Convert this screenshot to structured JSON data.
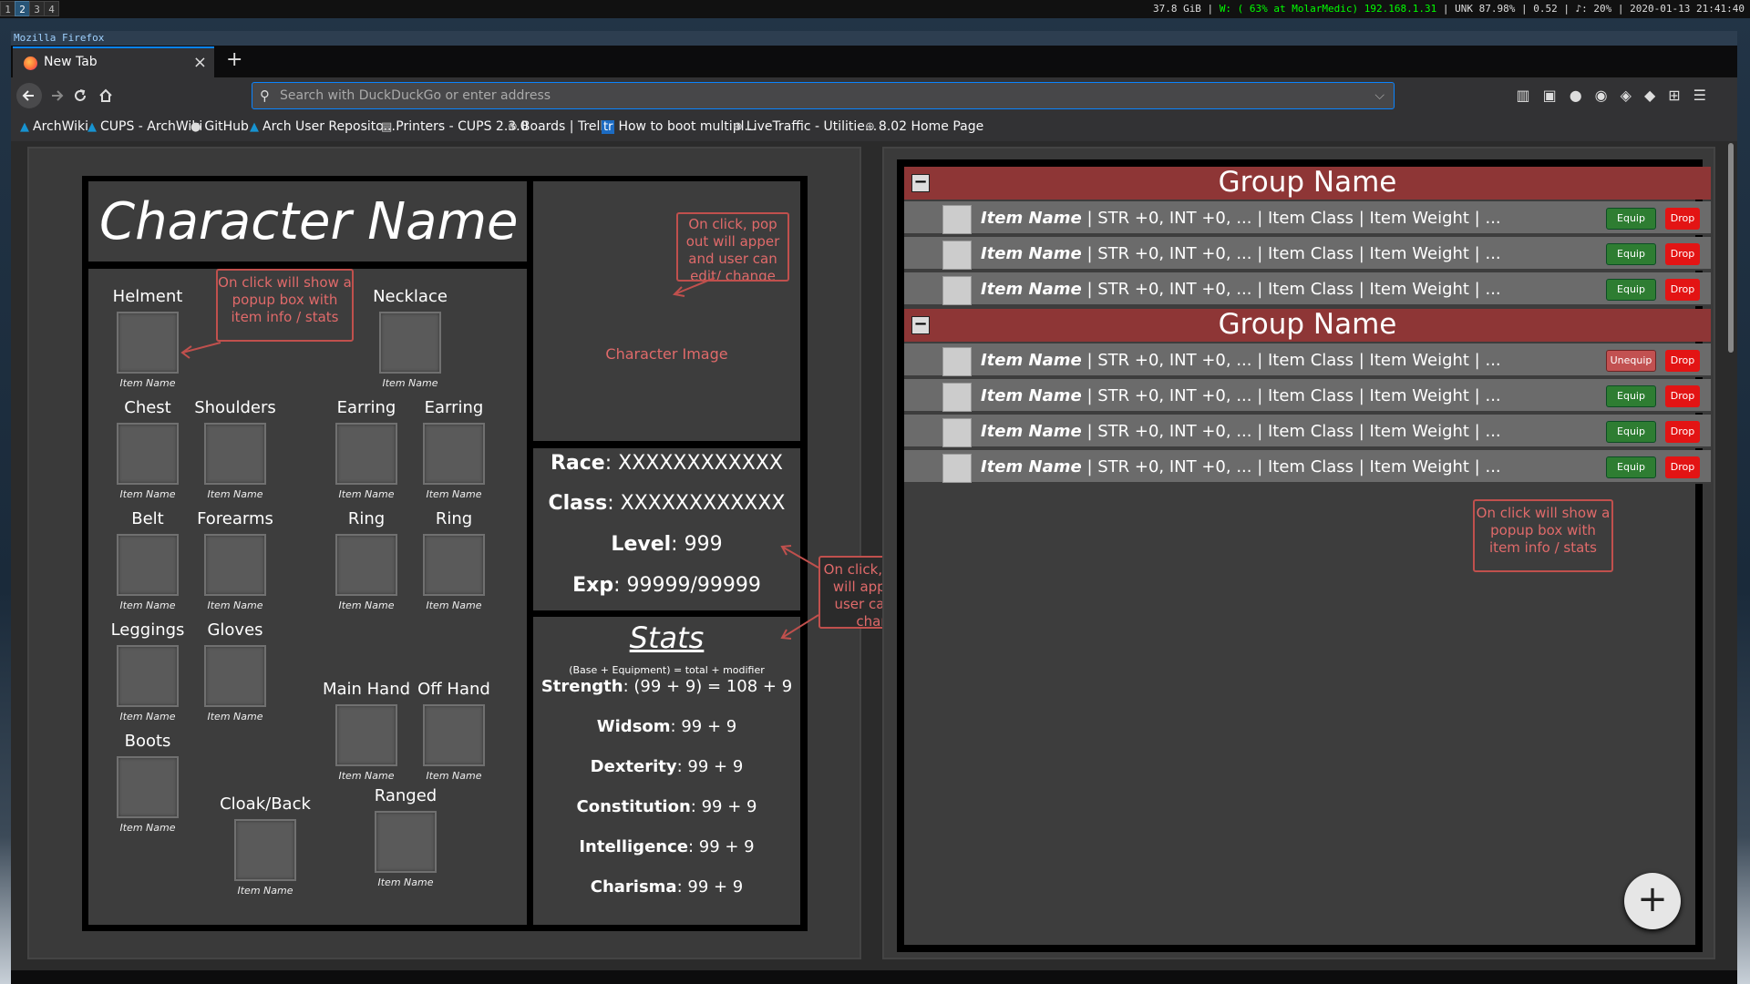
{
  "statusbar": {
    "workspaces": [
      "1",
      "2",
      "3",
      "4"
    ],
    "info": "37.8 GiB",
    "wifi": "W: ( 63% at MolarMedic) 192.168.1.31",
    "rest": "UNK 87.98% | 0.52 | ♪: 20% | 2020-01-13 21:41:40"
  },
  "browser": {
    "window_title": "Mozilla Firefox",
    "tab_label": "New Tab",
    "tab_close": "×",
    "new_tab": "+",
    "url_placeholder": "Search with DuckDuckGo or enter address",
    "bookmarks": [
      "ArchWiki",
      "CUPS - ArchWiki",
      "GitHub",
      "Arch User Reposito...",
      "Printers - CUPS 2.3.0",
      "Boards | Trello",
      "How to boot multipl...",
      "LiveTraffic - Utilitie...",
      "8.02 Home Page"
    ]
  },
  "character": {
    "name": "Character Name",
    "image_caption": "Character Image",
    "race_label": "Race",
    "race_value": ": XXXXXXXXXXXX",
    "class_label": "Class",
    "class_value": ": XXXXXXXXXXXX",
    "level_label": "Level",
    "level_value": ": 999",
    "exp_label": "Exp",
    "exp_value": ": 99999/99999"
  },
  "slots": [
    {
      "label": "Helment",
      "item": "Item Name"
    },
    {
      "label": "Necklace",
      "item": "Item Name"
    },
    {
      "label": "Chest",
      "item": "Item Name"
    },
    {
      "label": "Shoulders",
      "item": "Item Name"
    },
    {
      "label": "Earring",
      "item": "Item Name"
    },
    {
      "label": "Earring",
      "item": "Item Name"
    },
    {
      "label": "Belt",
      "item": "Item Name"
    },
    {
      "label": "Forearms",
      "item": "Item Name"
    },
    {
      "label": "Ring",
      "item": "Item Name"
    },
    {
      "label": "Ring",
      "item": "Item Name"
    },
    {
      "label": "Leggings",
      "item": "Item Name"
    },
    {
      "label": "Gloves",
      "item": "Item Name"
    },
    {
      "label": "Main Hand",
      "item": "Item Name"
    },
    {
      "label": "Off Hand",
      "item": "Item Name"
    },
    {
      "label": "Boots",
      "item": "Item Name"
    },
    {
      "label": "Cloak/Back",
      "item": "Item Name"
    },
    {
      "label": "Ranged",
      "item": "Item Name"
    }
  ],
  "stats": {
    "title": "Stats",
    "formula": "(Base + Equipment) = total + modifier",
    "rows": [
      {
        "name": "Strength",
        "value": ": (99 + 9) = 108 + 9"
      },
      {
        "name": "Widsom",
        "value": ": 99 + 9"
      },
      {
        "name": "Dexterity",
        "value": ": 99 + 9"
      },
      {
        "name": "Constitution",
        "value": ": 99 + 9"
      },
      {
        "name": "Intelligence",
        "value": ": 99 + 9"
      },
      {
        "name": "Charisma",
        "value": ": 99 + 9"
      }
    ]
  },
  "notes": {
    "slot_popup": "On click will show a popup box with item info / stats",
    "image_popout": "On click, pop out will apper and user can edit/ change",
    "info_popout": "On click, pop out will apper and user can edit/ change",
    "item_popup": "On click will show a popup box with item info / stats"
  },
  "inventory": {
    "groups": [
      {
        "name": "Group Name",
        "items": [
          {
            "name": "Item Name",
            "details": " | STR +0, INT +0, ... | Item Class | Item Weight | ...",
            "action": "Equip"
          },
          {
            "name": "Item Name",
            "details": " | STR +0, INT +0, ... | Item Class | Item Weight | ...",
            "action": "Equip"
          },
          {
            "name": "Item Name",
            "details": " | STR +0, INT +0, ... | Item Class | Item Weight | ...",
            "action": "Equip"
          }
        ]
      },
      {
        "name": "Group Name",
        "items": [
          {
            "name": "Item Name",
            "details": " | STR +0, INT +0, ... | Item Class | Item Weight | ...",
            "action": "Unequip"
          },
          {
            "name": "Item Name",
            "details": " | STR +0, INT +0, ... | Item Class | Item Weight | ...",
            "action": "Equip"
          },
          {
            "name": "Item Name",
            "details": " | STR +0, INT +0, ... | Item Class | Item Weight | ...",
            "action": "Equip"
          },
          {
            "name": "Item Name",
            "details": " | STR +0, INT +0, ... | Item Class | Item Weight | ...",
            "action": "Equip"
          }
        ]
      }
    ],
    "drop_label": "Drop",
    "collapse_symbol": "−",
    "add_symbol": "+"
  },
  "colors": {
    "group_header": "#8e3636",
    "equip": "#2e7d32",
    "unequip": "#c25151",
    "drop": "#e31414",
    "annotation": "#c0504d",
    "accent": "#0a84ff"
  }
}
